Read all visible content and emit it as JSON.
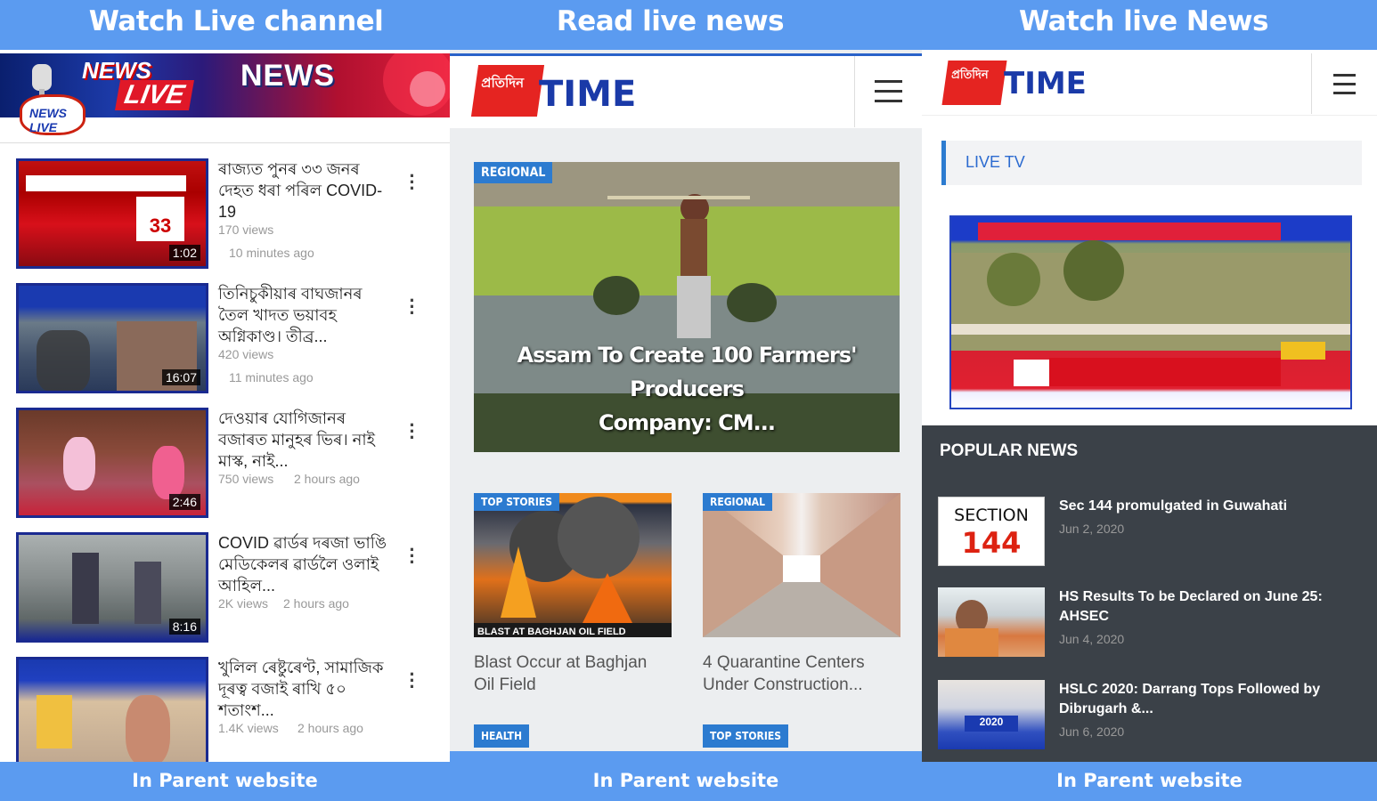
{
  "captions": {
    "top": [
      "Watch  Live channel",
      "Read live news",
      "Watch live News"
    ],
    "bottom": [
      "In Parent website",
      "In Parent website",
      "In Parent website"
    ]
  },
  "youtube": {
    "banner": {
      "text1": "NEWS",
      "text2": "LIVE",
      "text3": "NEWS",
      "logo_text": "NEWS LIVE"
    },
    "videos": [
      {
        "title": "ৰাজ্যত পুনৰ ৩৩ জনৰ দেহত ধৰা পৰিল COVID-19",
        "views": "170 views",
        "age": "10 minutes ago",
        "duration": "1:02"
      },
      {
        "title": "তিনিচুকীয়াৰ বাঘজানৰ তৈল খাদত ভয়াবহ অগ্নিকাণ্ড। তীব্ৰ...",
        "views": "420 views",
        "age": "11 minutes ago",
        "duration": "16:07"
      },
      {
        "title": "দেওয়াৰ যোগিজানৰ বজাৰত মানুহৰ ভিৰ। নাই মাস্ক, নাই...",
        "views": "750 views",
        "age": "2 hours ago",
        "duration": "2:46"
      },
      {
        "title": "COVID ৱাৰ্ডৰ দৰজা ভাঙি মেডিকেলৰ ৱাৰ্ডলৈ ওলাই আহিল...",
        "views": "2K views",
        "age": "2 hours ago",
        "duration": "8:16"
      },
      {
        "title": "খুলিল ৰেষ্টুৰেণ্ট, সামাজিক দূৰত্ব বজাই ৰাখি ৫০ শতাংশ...",
        "views": "1.4K views",
        "age": "2 hours ago",
        "duration": ""
      }
    ]
  },
  "site": {
    "logo_bengali": "প্ৰতিদিন",
    "logo_time": "TIME",
    "hero": {
      "tag": "REGIONAL",
      "caption_line1": "Assam To Create 100 Farmers' Producers",
      "caption_line2": "Company: CM..."
    },
    "cards": [
      {
        "tag": "TOP STORIES",
        "caption": "Blast Occur at Baghjan Oil Field",
        "img_text": "BLAST AT BAGHJAN OIL FIELD"
      },
      {
        "tag": "REGIONAL",
        "caption": "4 Quarantine Centers Under Construction..."
      }
    ],
    "bottom_tags": [
      "HEALTH",
      "TOP STORIES"
    ]
  },
  "live": {
    "section_label": "LIVE TV",
    "popular_title": "POPULAR NEWS",
    "items": [
      {
        "title": "Sec 144 promulgated in Guwahati",
        "date": "Jun 2, 2020",
        "thumb_line1": "SECTION",
        "thumb_line2": "144"
      },
      {
        "title": "HS Results To be Declared on June 25: AHSEC",
        "date": "Jun 4, 2020"
      },
      {
        "title": "HSLC 2020: Darrang Tops Followed by Dibrugarh &...",
        "date": "Jun 6, 2020",
        "thumb_line1": "2020"
      }
    ]
  },
  "colors": {
    "accent_blue": "#5b9bf0",
    "brand_red": "#e52421",
    "brand_blue": "#1a3aa8",
    "tag_blue": "#2c7bd0",
    "dark_panel": "#3b4148"
  }
}
